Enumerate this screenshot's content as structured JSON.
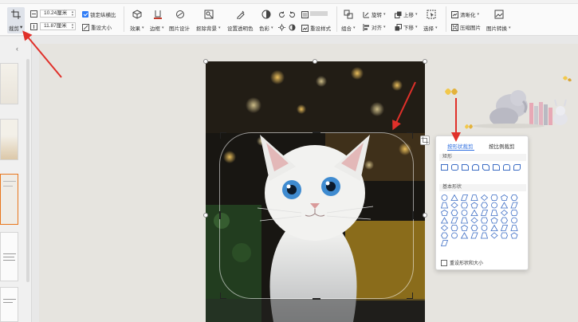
{
  "toolbar": {
    "crop": {
      "label": "裁剪"
    },
    "width_value": "10.24厘米",
    "height_value": "11.87厘米",
    "lock_ratio": {
      "label": "锁定纵横比",
      "checked": true
    },
    "reset_size": {
      "label": "重设大小"
    },
    "effects": {
      "label": "效果"
    },
    "border": {
      "label": "边框"
    },
    "image_design": {
      "label": "图片设计"
    },
    "remove_background": {
      "label": "抠除背景"
    },
    "set_transparent": {
      "label": "设置透明色"
    },
    "color": {
      "label": "色彩"
    },
    "reset_style": {
      "label": "重设样式"
    },
    "group": {
      "label": "组合"
    },
    "rotate": {
      "label": "旋转"
    },
    "align": {
      "label": "对齐"
    },
    "bring_forward": {
      "label": "上移"
    },
    "send_backward": {
      "label": "下移"
    },
    "select": {
      "label": "选择"
    },
    "clarify": {
      "label": "清晰化"
    },
    "compress": {
      "label": "压缩图片"
    },
    "convert": {
      "label": "图片转换"
    }
  },
  "popup": {
    "tabs": [
      {
        "label": "按形状裁剪",
        "active": true
      },
      {
        "label": "按比例裁剪",
        "active": false
      }
    ],
    "sections": [
      "矩形",
      "基本形状"
    ],
    "footer_checkbox": "重设形状和大小"
  },
  "colors": {
    "accent": "#2f6fe0",
    "annotation_arrow": "#e0302a",
    "selection_border": "#e8761c"
  }
}
